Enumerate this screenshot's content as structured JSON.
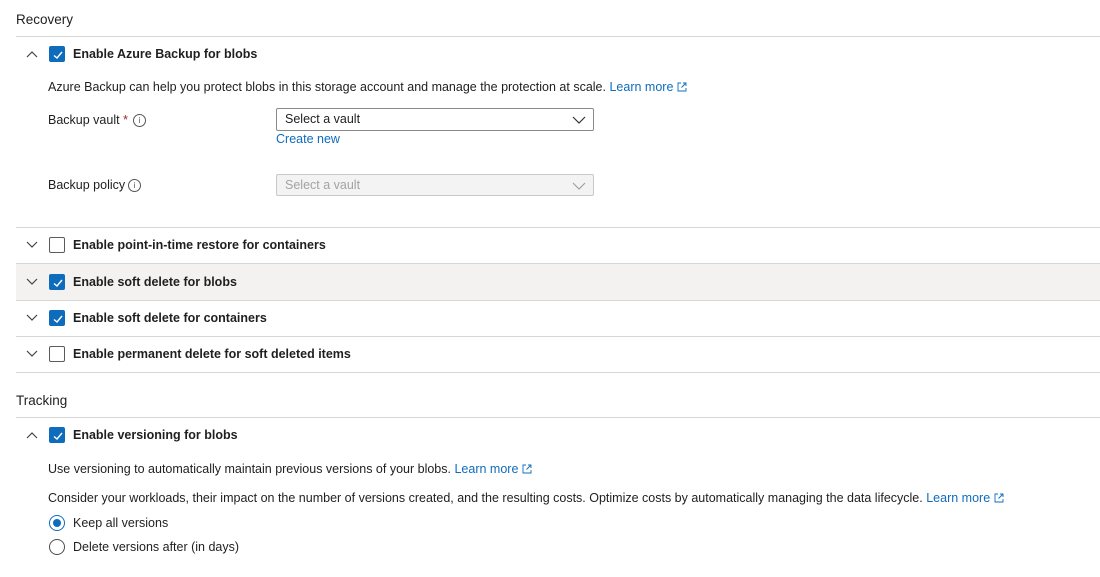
{
  "recovery": {
    "title": "Recovery",
    "azure_backup": {
      "label": "Enable Azure Backup for blobs",
      "checked": true,
      "expanded": true,
      "description": "Azure Backup can help you protect blobs in this storage account and manage the protection at scale.",
      "learn_more": "Learn more",
      "vault_label": "Backup vault",
      "required_mark": "*",
      "vault_placeholder": "Select a vault",
      "create_new": "Create new",
      "policy_label": "Backup policy",
      "policy_placeholder": "Select a vault"
    },
    "point_in_time": {
      "label": "Enable point-in-time restore for containers",
      "checked": false
    },
    "soft_delete_blobs": {
      "label": "Enable soft delete for blobs",
      "checked": true
    },
    "soft_delete_containers": {
      "label": "Enable soft delete for containers",
      "checked": true
    },
    "permanent_delete": {
      "label": "Enable permanent delete for soft deleted items",
      "checked": false
    }
  },
  "tracking": {
    "title": "Tracking",
    "versioning": {
      "label": "Enable versioning for blobs",
      "checked": true,
      "expanded": true,
      "description": "Use versioning to automatically maintain previous versions of your blobs.",
      "learn_more": "Learn more",
      "costs_text": "Consider your workloads, their impact on the number of versions created, and the resulting costs. Optimize costs by automatically managing the data lifecycle.",
      "costs_learn_more": "Learn more",
      "options": [
        "Keep all versions",
        "Delete versions after (in days)"
      ],
      "selected_option": "Keep all versions"
    }
  },
  "icons": {
    "chevron": "chevron-icon",
    "checkmark": "checkmark-icon",
    "external_link": "external-link-icon",
    "info": "info-icon"
  },
  "colors": {
    "accent": "#0f6cbd",
    "required": "#a4262c",
    "highlight_row": "#f3f2f1"
  }
}
